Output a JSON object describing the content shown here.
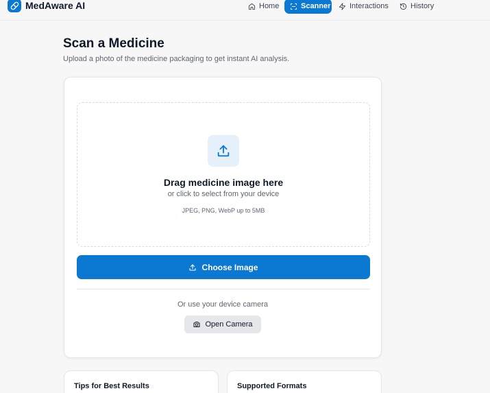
{
  "app": {
    "name": "MedAware AI",
    "logo_icon": "pill-icon",
    "accent_color": "#0b78d1"
  },
  "nav": {
    "items": [
      {
        "label": "Home",
        "icon": "home-icon",
        "active": false
      },
      {
        "label": "Scanner",
        "icon": "scan-icon",
        "active": true
      },
      {
        "label": "Interactions",
        "icon": "zap-icon",
        "active": false
      },
      {
        "label": "History",
        "icon": "history-icon",
        "active": false
      }
    ]
  },
  "page": {
    "title": "Scan a Medicine",
    "subtitle": "Upload a photo of the medicine packaging to get instant AI analysis."
  },
  "upload": {
    "icon": "upload-icon",
    "title": "Drag medicine image here",
    "subtitle": "or click to select from your device",
    "formats": "JPEG, PNG, WebP up to 5MB",
    "choose_button": "Choose Image"
  },
  "camera": {
    "prompt": "Or use your device camera",
    "button": "Open Camera",
    "icon": "camera-icon"
  },
  "info_cards": [
    {
      "title": "Tips for Best Results"
    },
    {
      "title": "Supported Formats"
    }
  ]
}
